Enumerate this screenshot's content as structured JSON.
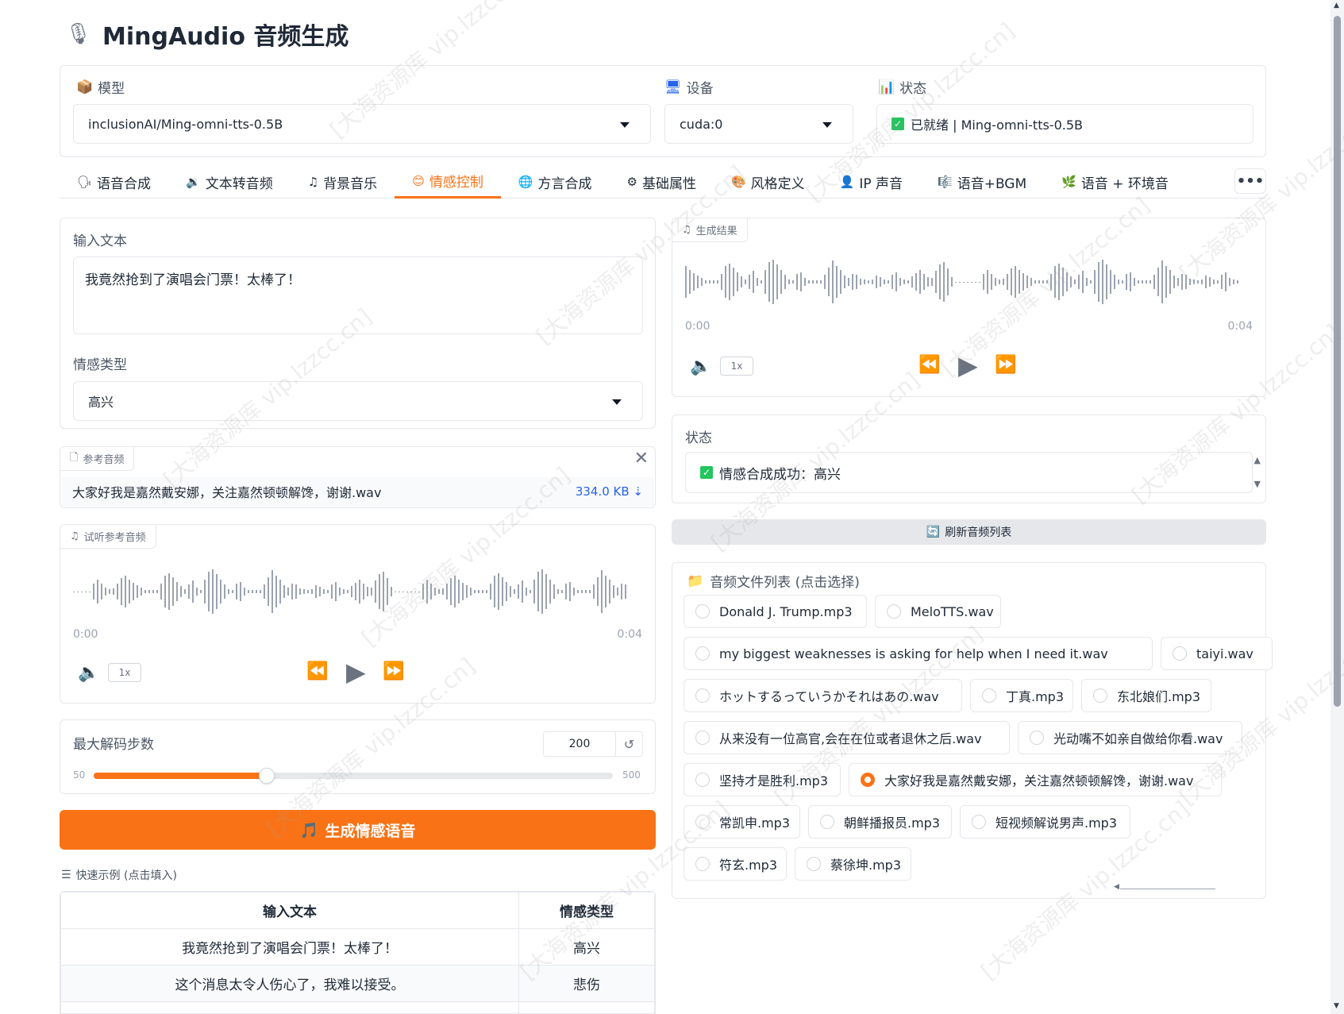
{
  "app": {
    "title": "MingAudio 音频生成",
    "brand_color": "#f97316",
    "watermark": "[大海资源库 vip.lzzcc.cn]"
  },
  "top": {
    "model": {
      "label": "模型",
      "icon": "package-icon",
      "value": "inclusionAI/Ming-omni-tts-0.5B"
    },
    "device": {
      "label": "设备",
      "icon": "monitor-icon",
      "value": "cuda:0"
    },
    "status": {
      "label": "状态",
      "icon": "bar-chart-icon",
      "value": "已就绪 | Ming-omni-tts-0.5B"
    }
  },
  "tabs": [
    {
      "label": "语音合成",
      "icon": "speech-icon"
    },
    {
      "label": "文本转音频",
      "icon": "speaker-icon"
    },
    {
      "label": "背景音乐",
      "icon": "music-note-icon"
    },
    {
      "label": "情感控制",
      "icon": "smile-icon",
      "active": true
    },
    {
      "label": "方言合成",
      "icon": "globe-icon"
    },
    {
      "label": "基础属性",
      "icon": "gear-icon"
    },
    {
      "label": "风格定义",
      "icon": "palette-icon"
    },
    {
      "label": "IP 声音",
      "icon": "person-icon"
    },
    {
      "label": "语音+BGM",
      "icon": "mic-music-icon"
    },
    {
      "label": "语音 + 环境音",
      "icon": "leaf-icon"
    }
  ],
  "more_label": "•••",
  "left": {
    "input_label": "输入文本",
    "input_value": "我竟然抢到了演唱会门票！太棒了！",
    "emotion_label": "情感类型",
    "emotion_value": "高兴",
    "ref_audio": {
      "tag": "参考音频",
      "filename": "大家好我是嘉然戴安娜，关注嘉然顿顿解馋，谢谢.wav",
      "size": "334.0 KB ⇣"
    },
    "preview": {
      "tag": "试听参考音频",
      "start": "0:00",
      "end": "0:04",
      "speed": "1x"
    },
    "steps": {
      "label": "最大解码步数",
      "value": "200",
      "min": "50",
      "max": "500",
      "fraction": 0.333
    },
    "generate_button": "生成情感语音",
    "examples_label": "快速示例 (点击填入)",
    "examples_headers": [
      "输入文本",
      "情感类型"
    ],
    "examples_rows": [
      [
        "我竟然抢到了演唱会门票！太棒了！",
        "高兴"
      ],
      [
        "这个消息太令人伤心了，我难以接受。",
        "悲伤"
      ]
    ]
  },
  "right": {
    "result": {
      "tag": "生成结果",
      "start": "0:00",
      "end": "0:04",
      "speed": "1x"
    },
    "status_label": "状态",
    "status_value": "情感合成成功：高兴",
    "refresh_button": "刷新音频列表",
    "file_list_label": "音频文件列表 (点击选择)",
    "files": [
      {
        "name": "Donald J. Trump.mp3",
        "selected": false
      },
      {
        "name": "MeloTTS.wav",
        "selected": false
      },
      {
        "name": "my biggest weaknesses is asking for help when I need it.wav",
        "selected": false
      },
      {
        "name": "taiyi.wav",
        "selected": false
      },
      {
        "name": "ホットするっていうかそれはあの.wav",
        "selected": false
      },
      {
        "name": "丁真.mp3",
        "selected": false
      },
      {
        "name": "东北娘们.mp3",
        "selected": false
      },
      {
        "name": "从来没有一位高官,会在在位或者退休之后.wav",
        "selected": false
      },
      {
        "name": "光动嘴不如亲自做给你看.wav",
        "selected": false
      },
      {
        "name": "坚持才是胜利.mp3",
        "selected": false
      },
      {
        "name": "大家好我是嘉然戴安娜，关注嘉然顿顿解馋，谢谢.wav",
        "selected": true
      },
      {
        "name": "常凯申.mp3",
        "selected": false
      },
      {
        "name": "朝鲜播报员.mp3",
        "selected": false
      },
      {
        "name": "短视频解说男声.mp3",
        "selected": false
      },
      {
        "name": "符玄.mp3",
        "selected": false
      },
      {
        "name": "蔡徐坤.mp3",
        "selected": false
      }
    ]
  }
}
